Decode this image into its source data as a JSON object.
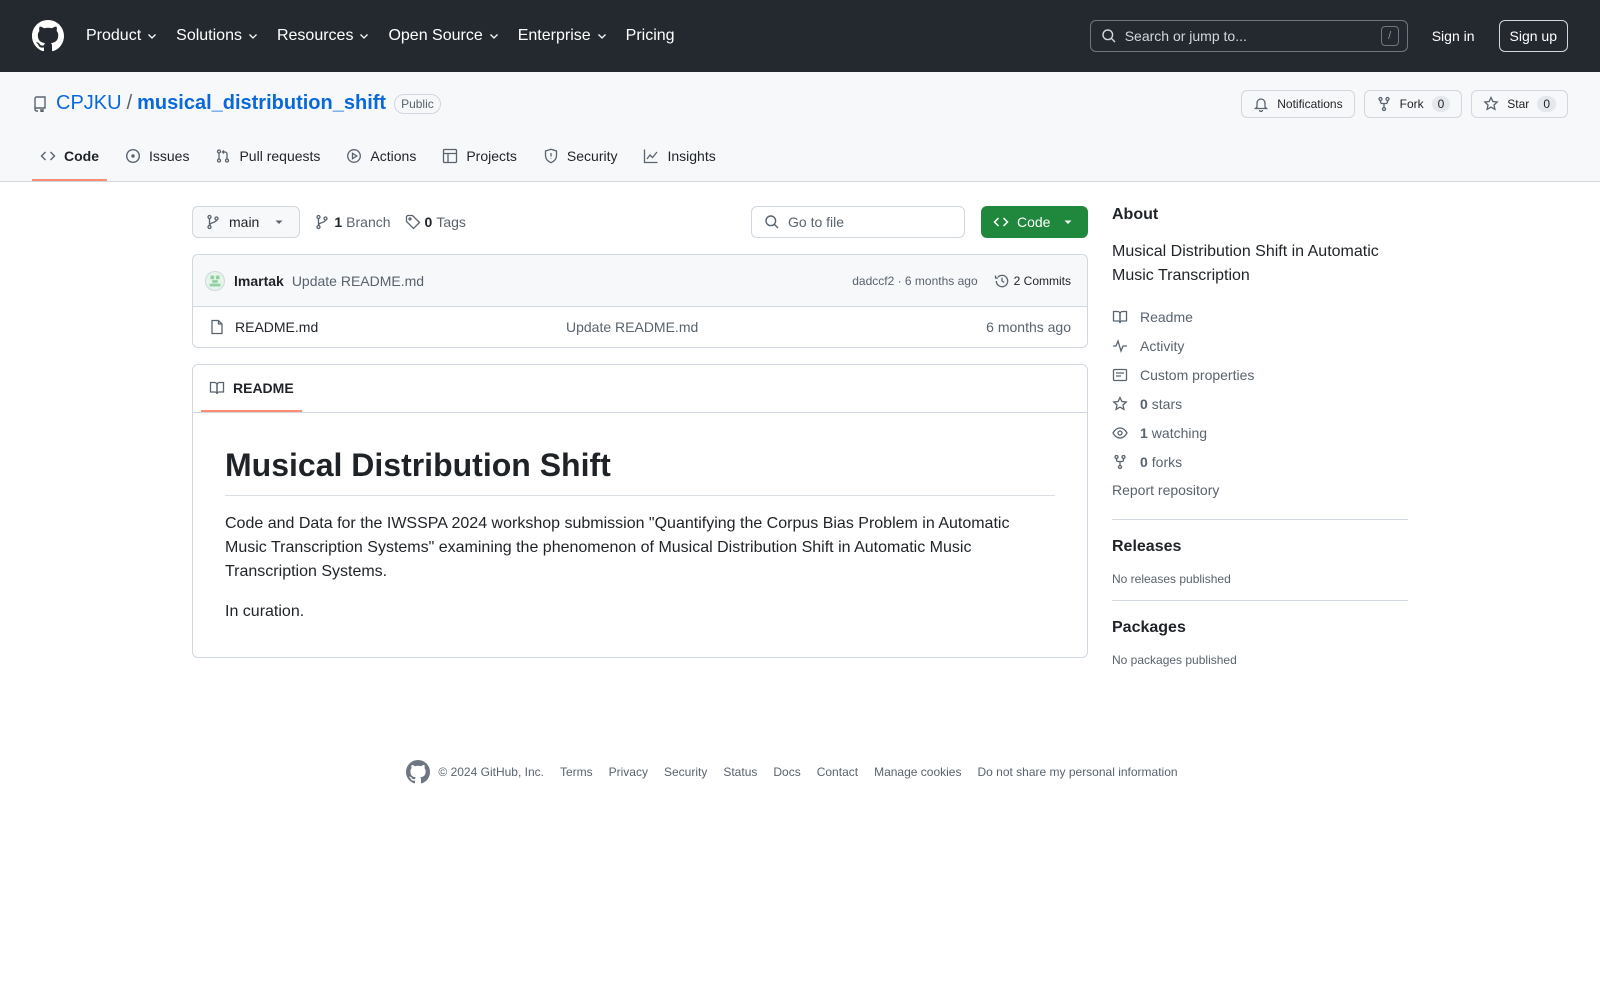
{
  "header": {
    "nav": [
      {
        "label": "Product",
        "chevron": true
      },
      {
        "label": "Solutions",
        "chevron": true
      },
      {
        "label": "Resources",
        "chevron": true
      },
      {
        "label": "Open Source",
        "chevron": true
      },
      {
        "label": "Enterprise",
        "chevron": true
      },
      {
        "label": "Pricing",
        "chevron": false
      }
    ],
    "search_placeholder": "Search or jump to...",
    "search_shortcut": "/",
    "sign_in": "Sign in",
    "sign_up": "Sign up"
  },
  "repo": {
    "owner": "CPJKU",
    "separator": "/",
    "name": "musical_distribution_shift",
    "visibility": "Public",
    "notifications_label": "Notifications",
    "fork_label": "Fork",
    "fork_count": "0",
    "star_label": "Star",
    "star_count": "0"
  },
  "tabs": [
    {
      "label": "Code",
      "icon": "code-icon",
      "active": true
    },
    {
      "label": "Issues",
      "icon": "issue-icon",
      "active": false
    },
    {
      "label": "Pull requests",
      "icon": "pull-request-icon",
      "active": false
    },
    {
      "label": "Actions",
      "icon": "play-icon",
      "active": false
    },
    {
      "label": "Projects",
      "icon": "table-icon",
      "active": false
    },
    {
      "label": "Security",
      "icon": "shield-icon",
      "active": false
    },
    {
      "label": "Insights",
      "icon": "graph-icon",
      "active": false
    }
  ],
  "filenav": {
    "branch": "main",
    "branch_count": "1",
    "branch_label": "Branch",
    "tag_count": "0",
    "tag_label": "Tags",
    "goto_placeholder": "Go to file",
    "code_button": "Code"
  },
  "commit": {
    "author": "lmartak",
    "message": "Update README.md",
    "meta": "dadccf2 · 6 months ago",
    "commits_label": "2 Commits"
  },
  "files": [
    {
      "name": "README.md",
      "message": "Update README.md",
      "time": "6 months ago"
    }
  ],
  "readme": {
    "tab_label": "README",
    "title": "Musical Distribution Shift",
    "paragraphs": [
      "Code and Data for the IWSSPA 2024 workshop submission \"Quantifying the Corpus Bias Problem in Automatic Music Transcription Systems\" examining the phenomenon of Musical Distribution Shift in Automatic Music Transcription Systems.",
      "In curation."
    ]
  },
  "sidebar": {
    "about_heading": "About",
    "about_text": "Musical Distribution Shift in Automatic Music Transcription",
    "readme_link": "Readme",
    "activity_link": "Activity",
    "custom_props_link": "Custom properties",
    "stars_count": "0",
    "stars_label": "stars",
    "watching_count": "1",
    "watching_label": "watching",
    "forks_count": "0",
    "forks_label": "forks",
    "report_link": "Report repository",
    "releases_heading": "Releases",
    "releases_text": "No releases published",
    "packages_heading": "Packages",
    "packages_text": "No packages published"
  },
  "footer": {
    "copyright": "© 2024 GitHub, Inc.",
    "links": [
      "Terms",
      "Privacy",
      "Security",
      "Status",
      "Docs",
      "Contact",
      "Manage cookies",
      "Do not share my personal information"
    ]
  },
  "colors": {
    "header_bg": "#24292f",
    "link": "#0969da",
    "accent_tab": "#fd8c73",
    "code_button": "#1f883d"
  }
}
